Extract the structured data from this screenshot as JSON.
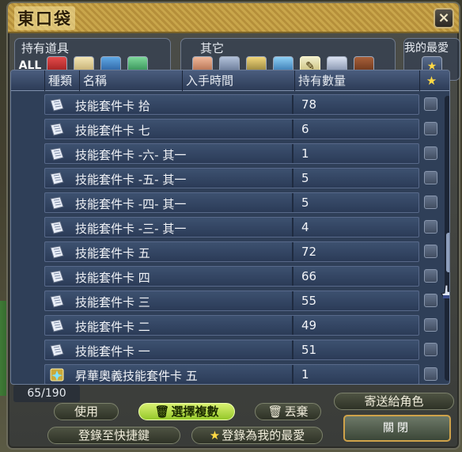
{
  "window": {
    "title": "東口袋",
    "close_icon": "×"
  },
  "groups": [
    {
      "label": "持有道具"
    },
    {
      "label": "其它"
    },
    {
      "label": "我的最愛"
    }
  ],
  "all_label": "ALL",
  "table": {
    "headers": [
      "種類",
      "名稱",
      "入手時間",
      "持有數量",
      "★"
    ],
    "rows": [
      {
        "name": "技能套件卡 拾",
        "qty": "78",
        "icon": "card-icon"
      },
      {
        "name": "技能套件卡 七",
        "qty": "6",
        "icon": "card-icon"
      },
      {
        "name": "技能套件卡 -六- 其一",
        "qty": "1",
        "icon": "card-icon"
      },
      {
        "name": "技能套件卡 -五- 其一",
        "qty": "5",
        "icon": "card-icon"
      },
      {
        "name": "技能套件卡 -四- 其一",
        "qty": "5",
        "icon": "card-icon"
      },
      {
        "name": "技能套件卡 -三- 其一",
        "qty": "4",
        "icon": "card-icon"
      },
      {
        "name": "技能套件卡 五",
        "qty": "72",
        "icon": "card-icon"
      },
      {
        "name": "技能套件卡 四",
        "qty": "66",
        "icon": "card-icon"
      },
      {
        "name": "技能套件卡 三",
        "qty": "55",
        "icon": "card-icon"
      },
      {
        "name": "技能套件卡 二",
        "qty": "49",
        "icon": "card-icon"
      },
      {
        "name": "技能套件卡 一",
        "qty": "51",
        "icon": "card-icon"
      },
      {
        "name": "昇華奧義技能套件卡 五",
        "qty": "1",
        "icon": "special-card-icon"
      }
    ]
  },
  "count": "65/190",
  "buttons": {
    "use": "使用",
    "multi_select": "選擇複數",
    "discard": "丟棄",
    "send_to_character": "寄送給角色",
    "register_shortcut": "登錄至快捷鍵",
    "register_favorite": "登錄為我的最愛",
    "close": "關閉"
  },
  "colors": {
    "accent": "#c9a64b",
    "selected": "#b5dc47",
    "list_bg": "#2f3f58"
  }
}
